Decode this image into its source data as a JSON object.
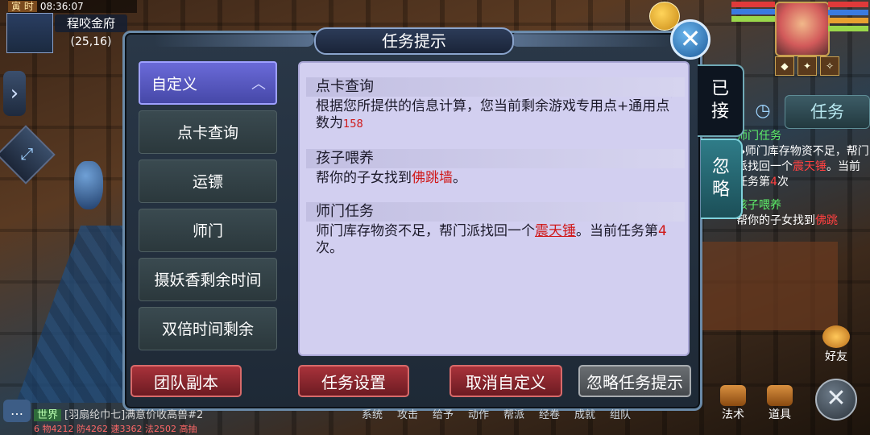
{
  "hud": {
    "time_tag": "寅 时",
    "time": "08:36:07",
    "location": "程咬金府",
    "coords": "(25,16)"
  },
  "dialog": {
    "title": "任务提示",
    "close_symbol": "✕"
  },
  "menu": {
    "items": [
      {
        "label": "自定义",
        "active": true
      },
      {
        "label": "点卡查询"
      },
      {
        "label": "运镖"
      },
      {
        "label": "师门"
      },
      {
        "label": "摄妖香剩余时间"
      },
      {
        "label": "双倍时间剩余"
      }
    ],
    "chevron": "︿"
  },
  "sections": [
    {
      "title": "点卡查询",
      "body_prefix": "根据您所提供的信息计算，您当前剩余游戏专用点+通用点数为",
      "value": "158"
    },
    {
      "title": "孩子喂养",
      "body_prefix": "帮你的子女找到",
      "highlight": "佛跳墙",
      "body_suffix": "。"
    },
    {
      "title": "师门任务",
      "body_prefix": "师门库存物资不足，帮门派找回一个",
      "highlight": "震天锤",
      "body_mid": "。当前任务第",
      "count": "4",
      "body_suffix": "次。"
    }
  ],
  "buttons": {
    "team_dungeon": "团队副本",
    "task_settings": "任务设置",
    "cancel_custom": "取消自定义",
    "ignore_hint": "忽略任务提示"
  },
  "side_tabs": {
    "accepted": "已接",
    "ignore": "忽略"
  },
  "tracker": {
    "task_label": "任务",
    "entries": [
      {
        "title": "师门任务",
        "text_a": "◆师门库存物资不足，帮门派找回一个",
        "red": "震天锤",
        "text_b": "。当前任务第",
        "count": "4",
        "text_c": "次"
      },
      {
        "title": "孩子喂养",
        "text_a": "帮你的子女找到",
        "red": "佛跳"
      }
    ]
  },
  "chat": {
    "channel": "世界",
    "message": "[羽扇纶巾七]满意价收高兽#2",
    "second_line": "6 物4212 防4262 速3362 法2502 高抽"
  },
  "bottom_menu": [
    "系统",
    "攻击",
    "给予",
    "动作",
    "帮派",
    "经卷",
    "成就",
    "组队"
  ],
  "right_icons": {
    "friends": "好友",
    "magic": "法术",
    "items": "道具"
  },
  "colors": {
    "accent_red": "#d01818",
    "quest_green": "#5ef06a",
    "panel_bg": "#d2cff0"
  }
}
